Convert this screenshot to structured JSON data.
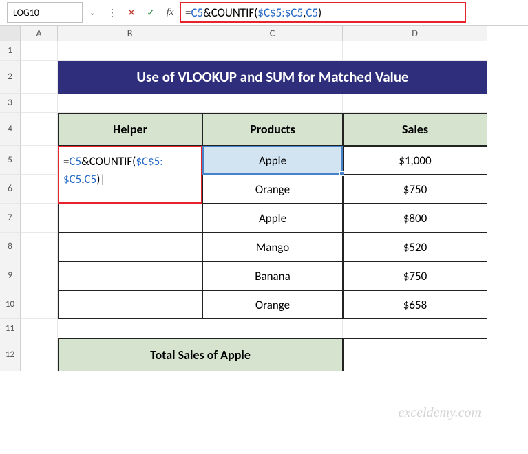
{
  "nameBox": "LOG10",
  "formulaBar": {
    "plain": "=C5&COUNTIF($C$5:$C5,C5)",
    "seg1": "=",
    "ref1": "C5",
    "seg2": "&COUNTIF(",
    "ref2": "$C$5:$C5",
    "seg3": ",",
    "ref3": "C5",
    "seg4": ")"
  },
  "columns": {
    "A": "A",
    "B": "B",
    "C": "C",
    "D": "D"
  },
  "rows": [
    "1",
    "2",
    "3",
    "4",
    "5",
    "6",
    "7",
    "8",
    "9",
    "10",
    "11",
    "12"
  ],
  "title": "Use of VLOOKUP and SUM for Matched Value",
  "headers": {
    "helper": "Helper",
    "products": "Products",
    "sales": "Sales"
  },
  "table": [
    {
      "product": "Apple",
      "sales": "$1,000"
    },
    {
      "product": "Orange",
      "sales": "$750"
    },
    {
      "product": "Apple",
      "sales": "$800"
    },
    {
      "product": "Mango",
      "sales": "$520"
    },
    {
      "product": "Banana",
      "sales": "$750"
    },
    {
      "product": "Orange",
      "sales": "$658"
    }
  ],
  "editingFormula": {
    "line1a": "=",
    "line1ref1": "C5",
    "line1b": "&COUNTIF(",
    "line1ref2": "$C$5:",
    "line2ref": "$C5",
    "line2a": ",",
    "line2ref2": "C5",
    "line2b": ")|"
  },
  "selectedCellValue": "Apple",
  "totalLabel": "Total Sales of Apple",
  "watermark": "exceldemy.com",
  "icons": {
    "cancel": "✕",
    "enter": "✓",
    "dropdown": "⌄",
    "divider": "⋮"
  }
}
